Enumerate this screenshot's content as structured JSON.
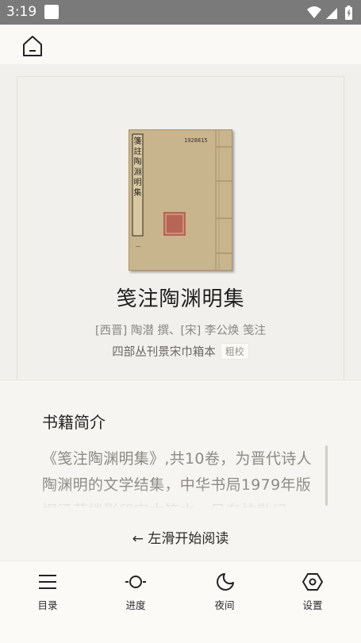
{
  "status_bar": {
    "time": "3:19"
  },
  "book": {
    "title": "笺注陶渊明集",
    "authors": "[西晋] 陶潜 撰、[宋] 李公焕 笺注",
    "edition": "四部丛刊景宋巾箱本",
    "badge": "粗校",
    "cover_spine_text": "箋註陶淵明集",
    "cover_label": "1928815"
  },
  "intro": {
    "heading": "书籍简介",
    "text": "《笺注陶渊明集》,共10卷，为晋代诗人陶渊明的文学结集，中华书局1979年版据涵芬楼影印宋巾箱本，另有校勘记。"
  },
  "swipe_hint": "← 左滑开始阅读",
  "nav": {
    "items": [
      {
        "label": "目录",
        "icon": "menu-icon"
      },
      {
        "label": "进度",
        "icon": "progress-icon"
      },
      {
        "label": "夜间",
        "icon": "night-mode-icon"
      },
      {
        "label": "设置",
        "icon": "settings-icon"
      }
    ]
  },
  "colors": {
    "status_bar": "#7a7a7a",
    "background": "#f1f0ed",
    "cover_paper": "#c9b58e",
    "seal_red": "#b4574a"
  }
}
